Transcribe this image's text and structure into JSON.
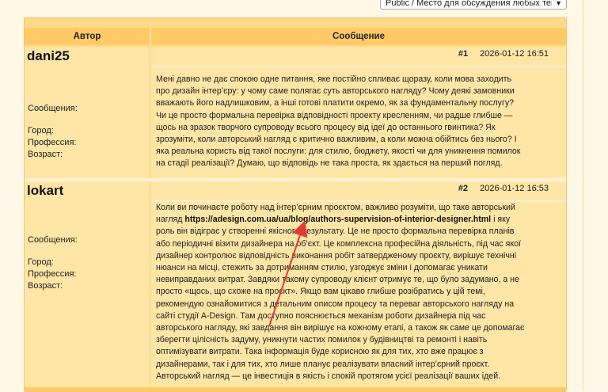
{
  "forum_select": {
    "selected": "Public / Место для обсуждения любых тем"
  },
  "table_header": {
    "author": "Автор",
    "message": "Сообщение"
  },
  "posts": [
    {
      "author": "dani25",
      "stats": {
        "messages": "Сообщения:",
        "city": "Город:",
        "profession": "Профессия:",
        "age": "Возраст:"
      },
      "number": "#1",
      "date": "2026-01-12 16:51",
      "text": "Мені давно не дає спокою одне питання, яке постійно спливає щоразу, коли мова заходить про дизайн інтер’єру: у чому саме полягає суть авторського нагляду? Чому деякі замовники вважають його надлишковим, а інші готові платити окремо, як за фундаментальну послугу? Чи це просто формальна перевірка відповідності проекту кресленням, чи радше глибше — щось на зразок творчого супроводу всього процесу від ідеї до останнього гвинтика? Як зрозуміти, коли авторський нагляд є критично важливим, а коли можна обійтись без нього? І яка реальна користь від такої послуги: для стилю, бюджету, якості чи для уникнення помилок на стадії реалізації? Думаю, що відповідь не така проста, як здається на перший погляд."
    },
    {
      "author": "lokart",
      "stats": {
        "messages": "Сообщения:",
        "city": "Город:",
        "profession": "Профессия:",
        "age": "Возраст:"
      },
      "number": "#2",
      "date": "2026-01-12 16:53",
      "text_before_link": "Коли ви починаєте роботу над інтер’єрним проєктом, важливо розуміти, що таке авторський нагляд ",
      "link": "https://adesign.com.ua/ua/blog/authors-supervision-of-interior-designer.html",
      "text_after_link": " і яку роль він відіграє у створенні якісного результату. Це не просто формальна перевірка планів або періодичні візити дизайнера на об’єкт. Це комплексна професійна діяльність, під час якої дизайнер контролює відповідність виконання робіт затвердженому проєкту, вирішує технічні нюанси на місці, стежить за дотриманням стилю, узгоджує зміни і допомагає уникати невиправданих витрат. Завдяки такому супроводу клієнт отримує те, що було задумано, а не просто «щось, що схоже на проєкт». Якщо вам цікаво глибше розібратись у цій темі, рекомендую ознайомитися з детальним описом процесу та переваг авторського нагляду на сайті студії A-Design. Там доступно пояснюється механізм роботи дизайнера під час авторського нагляду, які завдання він вирішує на кожному етапі, а також як саме це допомагає зберегти цілісність задуму, уникнути частих помилок у будівництві та ремонті і навіть оптимізувати витрати. Така інформація буде корисною як для тих, хто вже працює з дизайнерами, так і для тих, хто лише планує реалізувати власний інтер’єрний проєкт. Авторський нагляд — це інвестиція в якість і спокій протягом усієї реалізації ваших ідей."
    }
  ],
  "colors": {
    "accent": "#ffca66",
    "cell": "#ffe6a6",
    "annotation_arrow": "#e53935"
  },
  "icons": {
    "select_chevron": "chevron-down-icon"
  }
}
